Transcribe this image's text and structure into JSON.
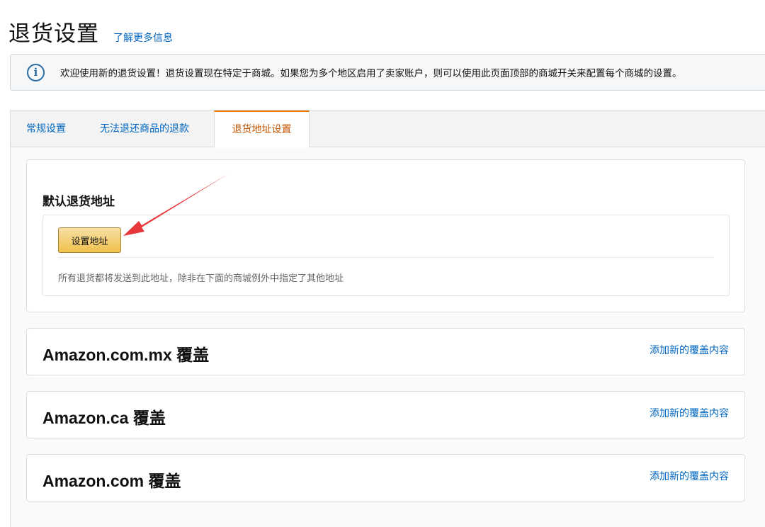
{
  "header": {
    "title": "退货设置",
    "learn_more": "了解更多信息"
  },
  "banner": {
    "icon": "info-icon",
    "text": "欢迎使用新的退货设置！退货设置现在特定于商城。如果您为多个地区启用了卖家账户，则可以使用此页面顶部的商城开关来配置每个商城的设置。"
  },
  "tabs": [
    {
      "label": "常规设置",
      "active": false
    },
    {
      "label": "无法退还商品的退款",
      "active": false
    },
    {
      "label": "退货地址设置",
      "active": true
    }
  ],
  "default_address": {
    "title": "默认退货地址",
    "button_label": "设置地址",
    "hint": "所有退货都将发送到此地址，除非在下面的商城例外中指定了其他地址"
  },
  "overrides": [
    {
      "title": "Amazon.com.mx 覆盖",
      "link": "添加新的覆盖内容"
    },
    {
      "title": "Amazon.ca 覆盖",
      "link": "添加新的覆盖内容"
    },
    {
      "title": "Amazon.com 覆盖",
      "link": "添加新的覆盖内容"
    }
  ],
  "colors": {
    "link": "#0066c0",
    "active_tab_text": "#c45500",
    "active_tab_border": "#e77600",
    "button_top": "#f7dfa5",
    "button_bottom": "#f0c14b",
    "annotation_arrow": "#e8373a"
  }
}
